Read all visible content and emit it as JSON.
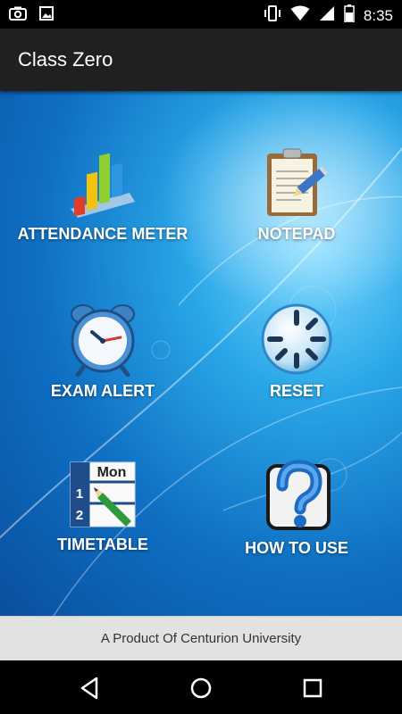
{
  "status_bar": {
    "time": "8:35",
    "left_icons": [
      "camera-icon",
      "image-icon"
    ],
    "right_icons": [
      "vibrate-icon",
      "wifi-icon",
      "signal-icon",
      "battery-icon"
    ]
  },
  "app_bar": {
    "title": "Class Zero"
  },
  "menu": {
    "attendance": {
      "label": "ATTENDANCE METER",
      "icon": "bar-chart-icon"
    },
    "notepad": {
      "label": "NOTEPAD",
      "icon": "notepad-icon"
    },
    "exam_alert": {
      "label": "EXAM ALERT",
      "icon": "alarm-clock-icon"
    },
    "reset": {
      "label": "RESET",
      "icon": "reset-icon"
    },
    "timetable": {
      "label": "TIMETABLE",
      "icon": "timetable-icon",
      "icon_text": {
        "day": "Mon",
        "row1": "1",
        "row2": "2"
      }
    },
    "how_to_use": {
      "label": "HOW TO USE",
      "icon": "help-icon"
    }
  },
  "footer": {
    "text": "A Product Of Centurion University"
  },
  "nav_bar": {
    "buttons": [
      "back-icon",
      "home-icon",
      "recents-icon"
    ]
  },
  "colors": {
    "app_bar": "#202020",
    "background_center": "#7ad8ff",
    "background_edge": "#0a4f9e",
    "footer": "#e2e2e2"
  }
}
